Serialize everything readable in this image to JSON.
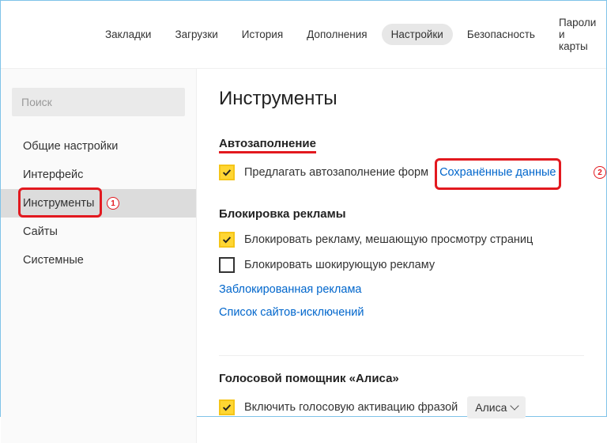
{
  "topnav": {
    "items": [
      {
        "label": "Закладки",
        "active": false
      },
      {
        "label": "Загрузки",
        "active": false
      },
      {
        "label": "История",
        "active": false
      },
      {
        "label": "Дополнения",
        "active": false
      },
      {
        "label": "Настройки",
        "active": true
      },
      {
        "label": "Безопасность",
        "active": false
      },
      {
        "label": "Пароли и карты",
        "active": false
      }
    ]
  },
  "sidebar": {
    "search_placeholder": "Поиск",
    "items": [
      {
        "label": "Общие настройки",
        "selected": false
      },
      {
        "label": "Интерфейс",
        "selected": false
      },
      {
        "label": "Инструменты",
        "selected": true
      },
      {
        "label": "Сайты",
        "selected": false
      },
      {
        "label": "Системные",
        "selected": false
      }
    ]
  },
  "main": {
    "title": "Инструменты",
    "autofill": {
      "heading": "Автозаполнение",
      "checkbox_suggest": {
        "checked": true,
        "label": "Предлагать автозаполнение форм"
      },
      "saved_data_link": "Сохранённые данные"
    },
    "adblock": {
      "heading": "Блокировка рекламы",
      "checkbox_block_intrusive": {
        "checked": true,
        "label": "Блокировать рекламу, мешающую просмотру страниц"
      },
      "checkbox_block_shocking": {
        "checked": false,
        "label": "Блокировать шокирующую рекламу"
      },
      "link_blocked": "Заблокированная реклама",
      "link_exceptions": "Список сайтов-исключений"
    },
    "alice": {
      "heading": "Голосовой помощник «Алиса»",
      "checkbox_voice": {
        "checked": true,
        "label": "Включить голосовую активацию фразой"
      },
      "dropdown_value": "Алиса"
    }
  },
  "annotations": {
    "callout1": "1",
    "callout2": "2"
  }
}
